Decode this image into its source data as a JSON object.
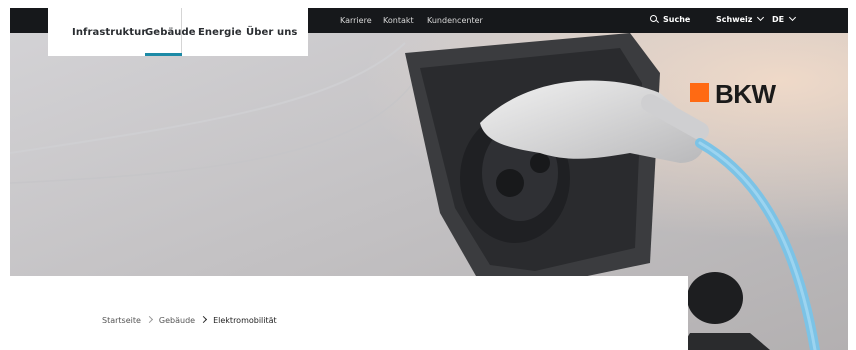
{
  "topbar": {
    "links": [
      "Karriere",
      "Kontakt",
      "Kundencenter"
    ],
    "search_label": "Suche",
    "country_label": "Schweiz",
    "language_label": "DE"
  },
  "main_nav": {
    "items": [
      "Infrastruktur",
      "Gebäude",
      "Energie",
      "Über uns"
    ],
    "active": "Gebäude"
  },
  "brand": {
    "logo_text": "BKW",
    "accent_color": "#ff6a13"
  },
  "breadcrumb": [
    "Startseite",
    "Gebäude",
    "Elektromobilität"
  ],
  "colors": {
    "topbar_bg": "#16181b",
    "active_underline": "#1c8aa6",
    "cable": "#7cc3e6"
  }
}
